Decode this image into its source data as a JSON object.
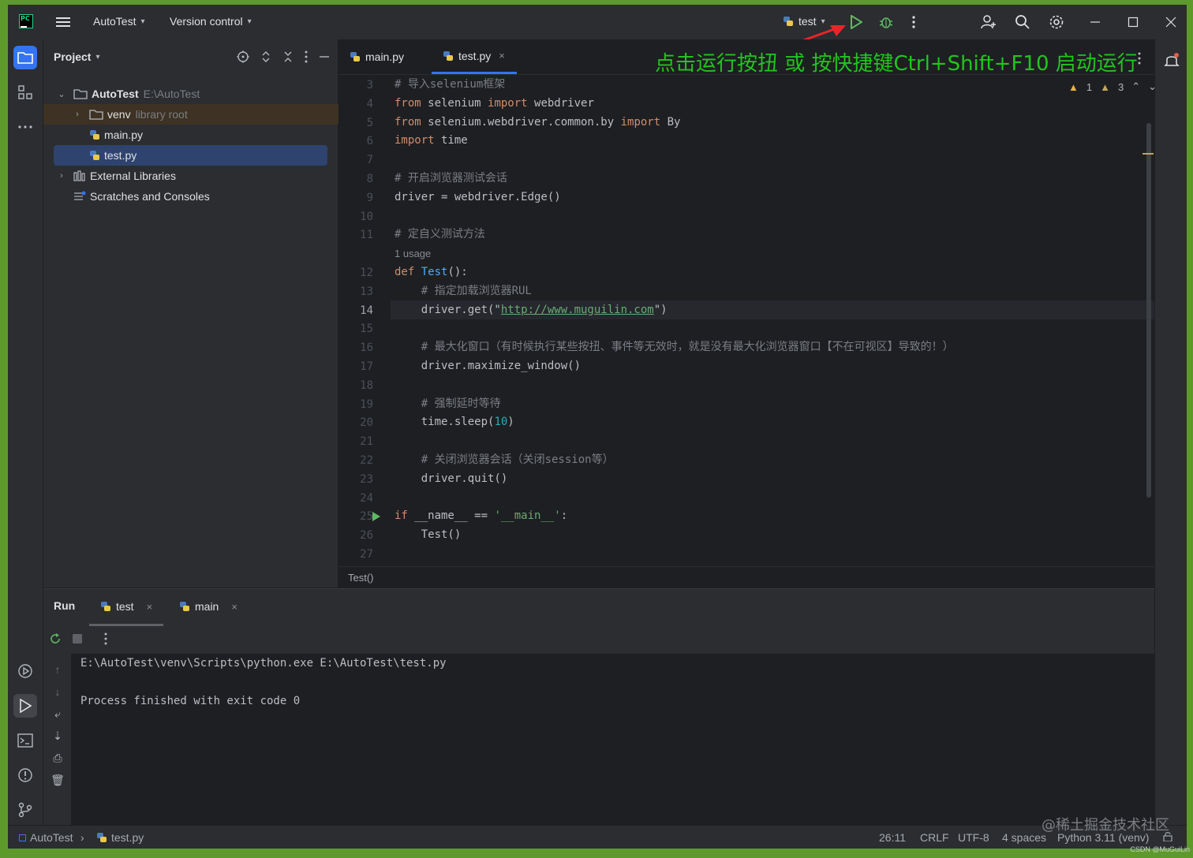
{
  "titlebar": {
    "project_name": "AutoTest",
    "vcs": "Version control",
    "run_config": "test"
  },
  "annotation": "点击运行按扭 或 按快捷键Ctrl+Shift+F10 启动运行",
  "project_panel": {
    "title": "Project",
    "tree": [
      {
        "label": "AutoTest",
        "hint": "E:\\AutoTest"
      },
      {
        "label": "venv",
        "hint": "library root"
      },
      {
        "label": "main.py"
      },
      {
        "label": "test.py"
      },
      {
        "label": "External Libraries"
      },
      {
        "label": "Scratches and Consoles"
      }
    ]
  },
  "editor": {
    "tabs": [
      {
        "label": "main.py"
      },
      {
        "label": "test.py"
      }
    ],
    "inspections": {
      "warnings": "1",
      "weak_warnings": "3"
    },
    "lines": [
      {
        "n": "3",
        "t": "# 导入selenium框架"
      },
      {
        "n": "4",
        "t": "from selenium import webdriver"
      },
      {
        "n": "5",
        "t": "from selenium.webdriver.common.by import By"
      },
      {
        "n": "6",
        "t": "import time"
      },
      {
        "n": "7",
        "t": ""
      },
      {
        "n": "8",
        "t": "# 开启浏览器测试会话"
      },
      {
        "n": "9",
        "t": "driver = webdriver.Edge()"
      },
      {
        "n": "10",
        "t": ""
      },
      {
        "n": "11",
        "t": "# 定自义测试方法"
      },
      {
        "n": "",
        "t": "1 usage"
      },
      {
        "n": "12",
        "t": "def Test():"
      },
      {
        "n": "13",
        "t": "    # 指定加载浏览器RUL"
      },
      {
        "n": "14",
        "t": "    driver.get(\"http://www.muguilin.com\")"
      },
      {
        "n": "15",
        "t": ""
      },
      {
        "n": "16",
        "t": "    # 最大化窗口（有时候执行某些按扭、事件等无效时，就是没有最大化浏览器窗口【不在可视区】导致的！）"
      },
      {
        "n": "17",
        "t": "    driver.maximize_window()"
      },
      {
        "n": "18",
        "t": ""
      },
      {
        "n": "19",
        "t": "    # 强制延时等待"
      },
      {
        "n": "20",
        "t": "    time.sleep(10)"
      },
      {
        "n": "21",
        "t": ""
      },
      {
        "n": "22",
        "t": "    # 关闭浏览器会话（关闭session等）"
      },
      {
        "n": "23",
        "t": "    driver.quit()"
      },
      {
        "n": "24",
        "t": ""
      },
      {
        "n": "25",
        "t": "if __name__ == '__main__':"
      },
      {
        "n": "26",
        "t": "    Test()"
      },
      {
        "n": "27",
        "t": ""
      }
    ],
    "breadcrumb": "Test()"
  },
  "run_panel": {
    "title": "Run",
    "tabs": [
      {
        "label": "test"
      },
      {
        "label": "main"
      }
    ],
    "console": [
      "E:\\AutoTest\\venv\\Scripts\\python.exe E:\\AutoTest\\test.py",
      "",
      "Process finished with exit code 0"
    ]
  },
  "statusbar": {
    "project": "AutoTest",
    "file": "test.py",
    "position": "26:11",
    "line_sep": "CRLF",
    "encoding": "UTF-8",
    "indent": "4 spaces",
    "interpreter": "Python 3.11 (venv)"
  },
  "watermark": "@稀土掘金技术社区",
  "watermark_small": "CSDN @MuGuiLin",
  "colors": {
    "accent": "#3574f0",
    "annotation": "#22c41f",
    "run": "#5fb865"
  }
}
